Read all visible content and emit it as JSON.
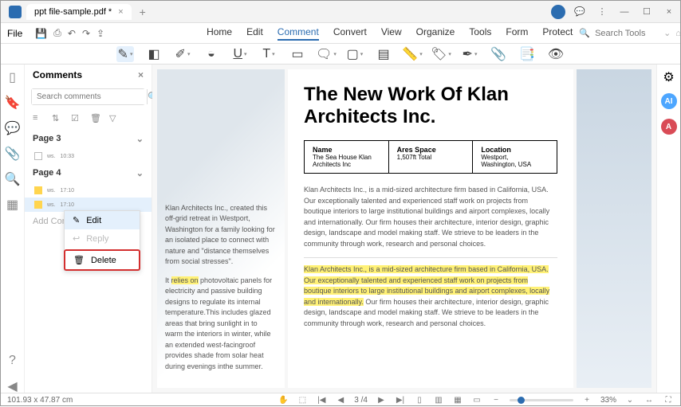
{
  "tab_title": "ppt file-sample.pdf *",
  "file_menu": "File",
  "menu": [
    "Home",
    "Edit",
    "Comment",
    "Convert",
    "View",
    "Organize",
    "Tools",
    "Form",
    "Protect"
  ],
  "active_menu": 2,
  "search_placeholder": "Search Tools",
  "comments": {
    "title": "Comments",
    "search_placeholder": "Search comments",
    "page3": "Page 3",
    "page4": "Page 4",
    "item1_author": "ws.",
    "item1_time": "10:33",
    "item2_author": "ws.",
    "item2_time": "17:10",
    "item3_author": "ws.",
    "item3_time": "17:10",
    "add_comment": "Add Com"
  },
  "context_menu": {
    "edit": "Edit",
    "reply": "Reply",
    "delete": "Delete"
  },
  "doc": {
    "col1_text": "Klan Architects Inc., created this off-grid retreat in Westport, Washington for a family looking for an isolated place to connect with nature and \"distance themselves from social stresses\".",
    "col1_para2a": "It ",
    "col1_hl": "relies on",
    "col1_para2b": " photovoltaic panels for electricity and passive building designs to regulate its internal temperature.This includes glazed areas that bring sunlight in to warm the interiors in winter, while an extended west-facingroof provides shade from solar heat during evenings inthe summer.",
    "title": "The New Work Of Klan Architects Inc.",
    "name_h": "Name",
    "name_v1": "The Sea House Klan",
    "name_v2": "Architects Inc",
    "area_h": "Ares Space",
    "area_v": "1,507ft Total",
    "loc_h": "Location",
    "loc_v1": "Westport,",
    "loc_v2": "Washington, USA",
    "p1": "Klan Architects Inc., is a mid-sized architecture firm based in California, USA. Our exceptionally talented and experienced staff work on projects from boutique interiors to large institutional buildings and airport complexes, locally and internationally. Our firm houses their architecture, interior design, graphic design, landscape and model making staff. We strieve to be leaders in the community through work, research and personal choices.",
    "p2_hl": "Klan Architects Inc., is a mid-sized architecture firm based in California, USA. Our exceptionally talented and experienced staff work on projects from boutique interiors to large institutional buildings and airport complexes, locally and internationally.",
    "p2_rest": " Our firm houses their architecture, interior design, graphic design, landscape and model making staff. We strieve to be leaders in the community through work, research and personal choices."
  },
  "status": {
    "dimensions": "101.93 x 47.87 cm",
    "page_current": "3",
    "page_total": "/4",
    "zoom": "33%"
  },
  "right_rail": {
    "ai": "AI",
    "tr": "A"
  }
}
